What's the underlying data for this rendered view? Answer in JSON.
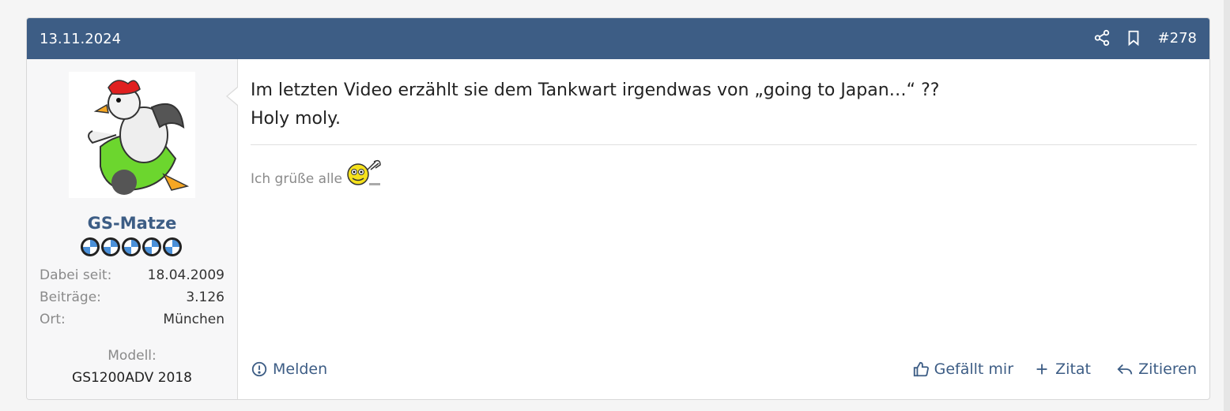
{
  "post": {
    "date": "13.11.2024",
    "number": "#278",
    "message_lines": [
      "Im letzten Video erzählt sie dem Tankwart irgendwas von „going to Japan…“ ??",
      "Holy moly."
    ],
    "signature": "Ich grüße alle"
  },
  "user": {
    "name": "GS-Matze",
    "rank_count": 5,
    "info": [
      {
        "label": "Dabei seit:",
        "value": "18.04.2009"
      },
      {
        "label": "Beiträge:",
        "value": "3.126"
      },
      {
        "label": "Ort:",
        "value": "München"
      }
    ],
    "modell_label": "Modell:",
    "modell_value": "GS1200ADV 2018"
  },
  "actions": {
    "report": "Melden",
    "like": "Gefällt mir",
    "quote_plus": "Zitat",
    "quote": "Zitieren"
  },
  "icons": {
    "share": "share-icon",
    "bookmark": "bookmark-icon",
    "report": "alert-circle-icon",
    "like": "thumbs-up-icon",
    "quote_plus": "plus-icon",
    "quote": "reply-icon"
  },
  "colors": {
    "header_bg": "#3d5d85",
    "accent": "#3d5d85"
  }
}
